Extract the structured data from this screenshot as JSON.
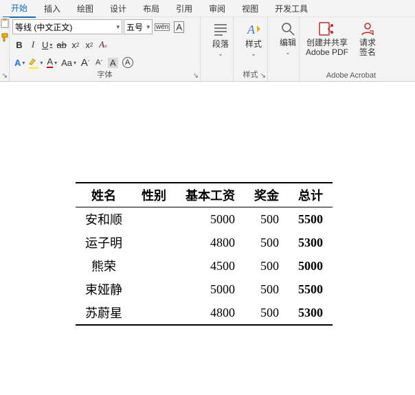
{
  "tabs": {
    "t0": "开始",
    "t1": "插入",
    "t2": "绘图",
    "t3": "设计",
    "t4": "布局",
    "t5": "引用",
    "t6": "审阅",
    "t7": "视图",
    "t8": "开发工具"
  },
  "font": {
    "name": "等线 (中文正文)",
    "size": "五号",
    "wen": "wén",
    "boxA": "A",
    "bold": "B",
    "italic": "I",
    "underline": "U",
    "strike": "ab",
    "sub": "x",
    "subN": "2",
    "sup": "x",
    "supN": "2",
    "clear": "A",
    "textfx": "A",
    "highlight": "ab",
    "fontcolor": "A",
    "charShade": "Aa",
    "grow": "A",
    "growSup": "ˆ",
    "shrink": "A",
    "shrinkSup": "ˇ",
    "shadeA": "A",
    "borderA": "A",
    "group": "字体"
  },
  "para": {
    "label": "段落",
    "group": "段落"
  },
  "styles": {
    "label": "样式",
    "group": "样式",
    "letter": "A"
  },
  "editing": {
    "label": "编辑"
  },
  "acrobat": {
    "create": "创建并共享",
    "create2": "Adobe PDF",
    "sign": "请求",
    "sign2": "签名",
    "group": "Adobe Acrobat"
  },
  "chart_data": {
    "type": "table",
    "headers": [
      "姓名",
      "性别",
      "基本工资",
      "奖金",
      "总计"
    ],
    "rows": [
      {
        "name": "安和顺",
        "sex": "",
        "base": 5000,
        "bonus": 500,
        "total": 5500
      },
      {
        "name": "运子明",
        "sex": "",
        "base": 4800,
        "bonus": 500,
        "total": 5300
      },
      {
        "name": "熊荣",
        "sex": "",
        "base": 4500,
        "bonus": 500,
        "total": 5000
      },
      {
        "name": "束娅静",
        "sex": "",
        "base": 5000,
        "bonus": 500,
        "total": 5500
      },
      {
        "name": "苏蔚星",
        "sex": "",
        "base": 4800,
        "bonus": 500,
        "total": 5300
      }
    ]
  }
}
